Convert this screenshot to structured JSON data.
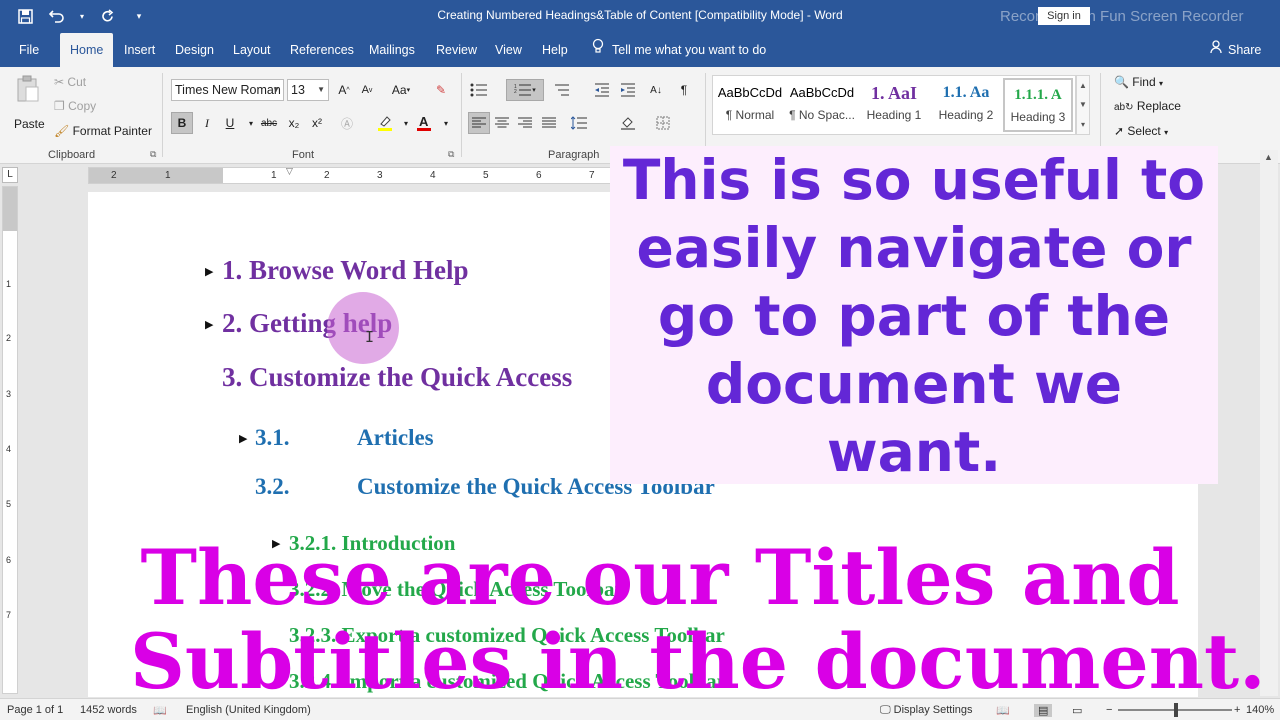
{
  "window": {
    "title": "Creating Numbered Headings&Table of Content [Compatibility Mode]  -  Word",
    "sign_in": "Sign in",
    "recorder_watermark": "Recorded with Fun Screen Recorder",
    "qat_icons": [
      "save-icon",
      "undo-icon",
      "redo-icon",
      "customize-qat-icon"
    ]
  },
  "tabs": {
    "file": "File",
    "home": "Home",
    "insert": "Insert",
    "design": "Design",
    "layout": "Layout",
    "references": "References",
    "mailings": "Mailings",
    "review": "Review",
    "view": "View",
    "help": "Help",
    "tell_me": "Tell me what you want to do",
    "share": "Share"
  },
  "clipboard": {
    "paste": "Paste",
    "cut": "Cut",
    "copy": "Copy",
    "format_painter": "Format Painter",
    "label": "Clipboard"
  },
  "font": {
    "name": "Times New Roman",
    "size": "13",
    "label": "Font",
    "bold": "B",
    "italic": "I",
    "underline": "U",
    "strike": "abc",
    "subscript": "x₂",
    "superscript": "x²",
    "grow": "A",
    "shrink": "A",
    "case": "Aa"
  },
  "paragraph": {
    "label": "Paragraph"
  },
  "styles": {
    "items": [
      {
        "preview": "AaBbCcDd",
        "name": "¶ Normal"
      },
      {
        "preview": "AaBbCcDd",
        "name": "¶ No Spac..."
      },
      {
        "preview": "1.  AaI",
        "name": "Heading 1"
      },
      {
        "preview": "1.1.  Aa",
        "name": "Heading 2"
      },
      {
        "preview": "1.1.1.  A",
        "name": "Heading 3"
      }
    ]
  },
  "editing": {
    "find": "Find",
    "replace": "Replace",
    "select": "Select"
  },
  "rulers": {
    "h_ticks": [
      "2",
      "1",
      "1",
      "2",
      "3",
      "4",
      "5",
      "6",
      "7"
    ],
    "v_ticks": [
      "1",
      "2",
      "3",
      "4",
      "5",
      "6",
      "7"
    ]
  },
  "document": {
    "h1_1": "1.  Browse Word Help",
    "h1_2": "2.  Getting help",
    "h1_3": "3.  Customize the Quick Access",
    "h2_1_num": "3.1.",
    "h2_1_text": "Articles",
    "h2_2_num": "3.2.",
    "h2_2_text": "Customize the Quick Access Toolbar",
    "h3_1": "3.2.1.  Introduction",
    "h3_2": "3.2.2.  Move the Quick Access Toolbar",
    "h3_3": "3.2.3.  Export a customized Quick Access Toolbar",
    "h3_4": "3.2.4.  Import a customized Quick Access Toolbar"
  },
  "overlays": {
    "top_line1": "This is so useful to",
    "top_line2": "easily navigate or",
    "top_line3": "go to part of the",
    "top_line4": "document we",
    "top_line5": "want.",
    "bottom_line1": "These are our Titles and",
    "bottom_line2": "Subtitles in the document."
  },
  "status": {
    "page": "Page 1 of 1",
    "words": "1452 words",
    "language": "English (United Kingdom)",
    "display_settings": "Display Settings",
    "zoom": "140%"
  },
  "colors": {
    "title_bar": "#2b579a",
    "heading1": "#7030a0",
    "heading2": "#1f6fb0",
    "heading3": "#23a84a",
    "overlay_top_text": "#6327d6",
    "overlay_bottom_text": "#d900e6"
  }
}
